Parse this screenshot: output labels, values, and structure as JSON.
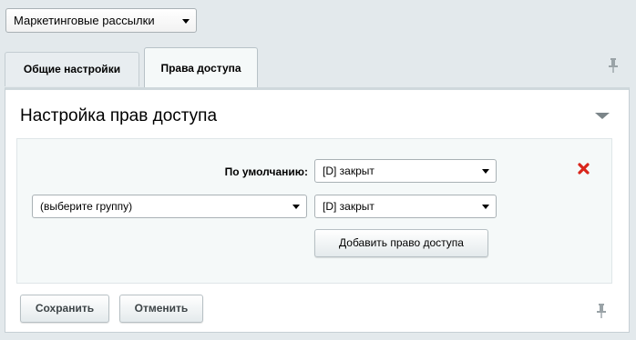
{
  "module_select": {
    "value": "Маркетинговые рассылки"
  },
  "tabs": [
    {
      "label": "Общие настройки",
      "active": false
    },
    {
      "label": "Права доступа",
      "active": true
    }
  ],
  "panel": {
    "title": "Настройка прав доступа"
  },
  "access": {
    "default_label": "По умолчанию:",
    "default_level": "[D] закрыт",
    "group_placeholder": "(выберите группу)",
    "group_level": "[D] закрыт",
    "add_button": "Добавить право доступа"
  },
  "footer": {
    "save_label": "Сохранить",
    "cancel_label": "Отменить"
  },
  "colors": {
    "background": "#e3e9ec",
    "panel": "#ffffff",
    "rights_box": "#f5f9f9",
    "delete": "#d9261c"
  },
  "icons": [
    "caret-down-icon",
    "pin-icon",
    "collapse-arrow-icon",
    "delete-icon"
  ]
}
